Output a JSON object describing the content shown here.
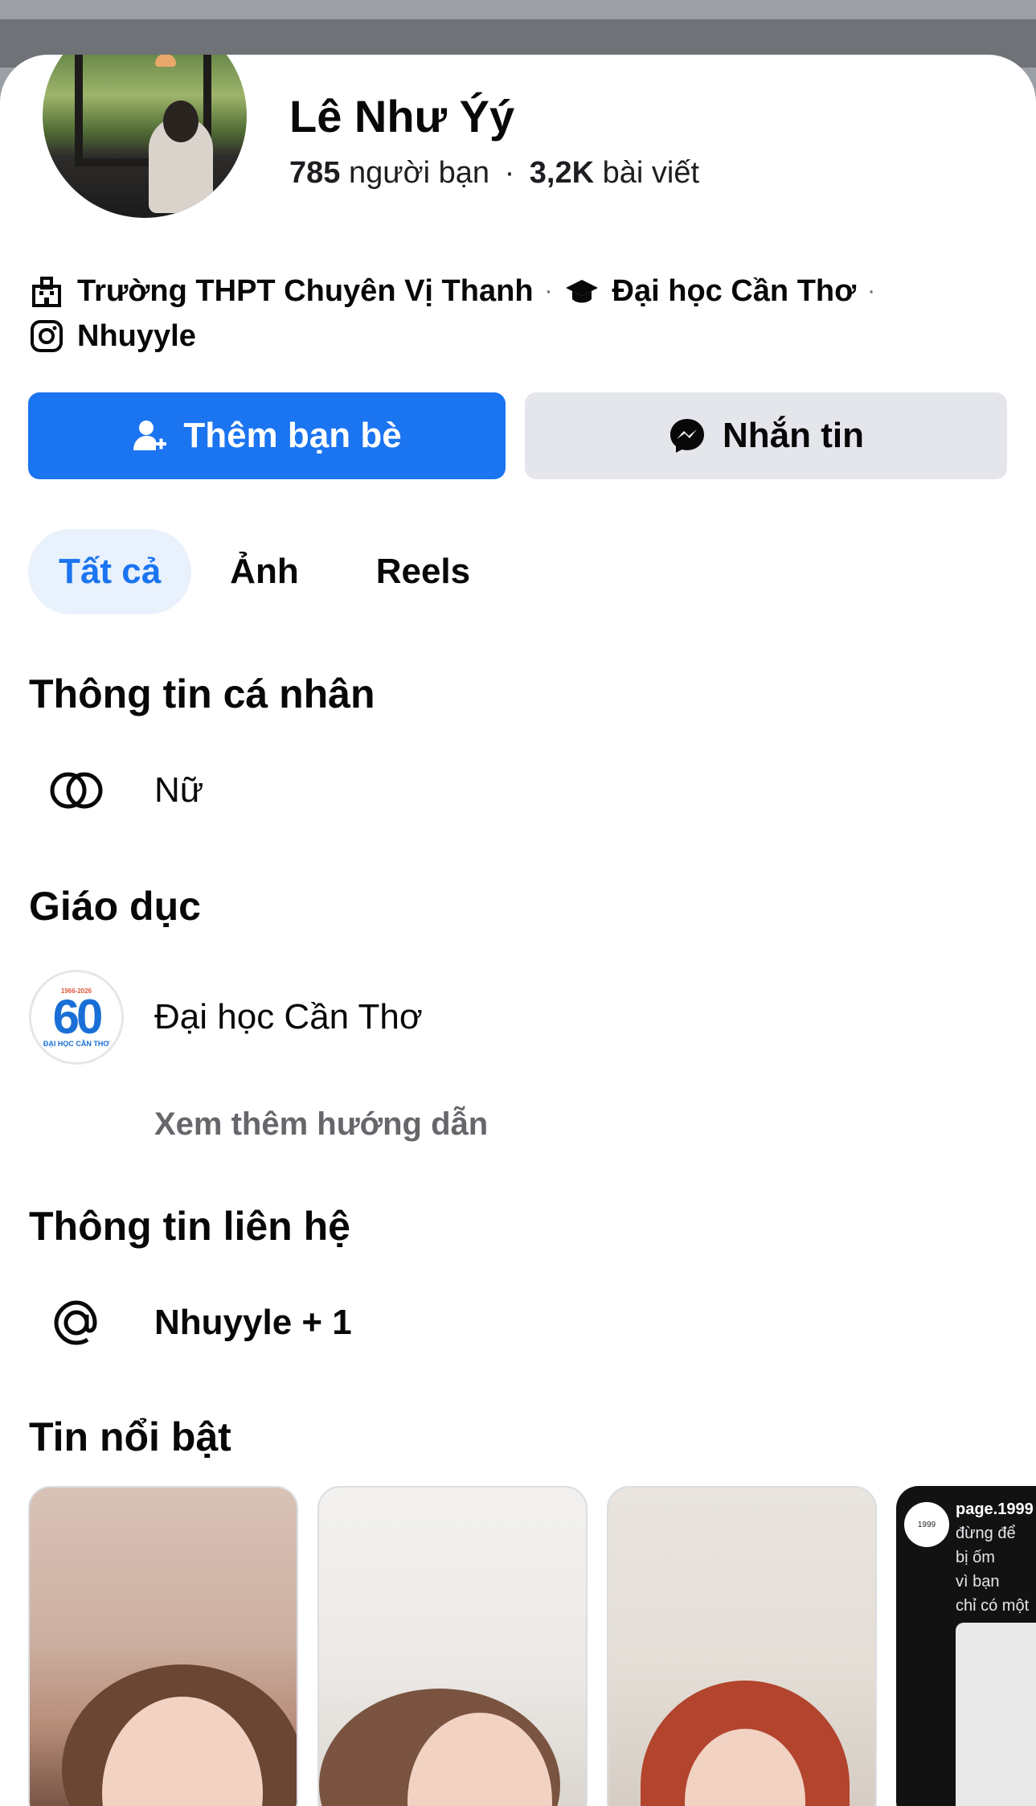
{
  "profile": {
    "name": "Lê Như Ýý",
    "friends_count": "785",
    "friends_label": "người bạn",
    "posts_count": "3,2K",
    "posts_label": "bài viết",
    "separator": "·"
  },
  "intro": {
    "high_school": "Trường THPT Chuyên Vị Thanh",
    "university": "Đại học Cần Thơ",
    "instagram": "Nhuyyle"
  },
  "actions": {
    "add_friend": "Thêm bạn bè",
    "message": "Nhắn tin"
  },
  "tabs": [
    "Tất cả",
    "Ảnh",
    "Reels"
  ],
  "personal_info": {
    "title": "Thông tin cá nhân",
    "gender": "Nữ"
  },
  "education": {
    "title": "Giáo dục",
    "school_name": "Đại học Cần Thơ",
    "logo_number": "60",
    "logo_years": "1966-2026",
    "logo_caption": "ĐẠI HỌC CẦN THƠ",
    "see_more": "Xem thêm hướng dẫn"
  },
  "contact": {
    "title": "Thông tin liên hệ",
    "value": "Nhuyyle + 1"
  },
  "featured": {
    "title": "Tin nổi bật",
    "story4": {
      "avatar_text": "1999",
      "username": "page.1999",
      "lines": [
        "đừng để",
        "bị ốm",
        "vì bạn",
        "chỉ có một"
      ]
    }
  },
  "colors": {
    "primary": "#1b74f0",
    "tab_active_bg": "#e8f1fc",
    "secondary_button": "#e4e6eb",
    "muted_text": "#65676b"
  },
  "icons": [
    "office-building-icon",
    "graduation-cap-icon",
    "instagram-icon",
    "add-friend-icon",
    "messenger-icon",
    "gender-icon",
    "at-sign-icon"
  ]
}
